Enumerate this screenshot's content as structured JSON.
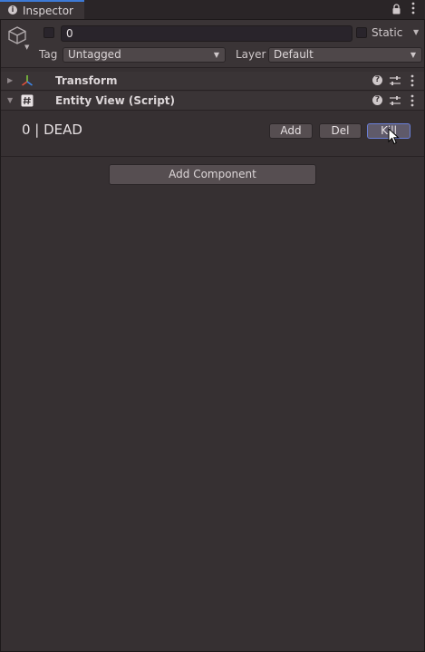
{
  "window": {
    "tab_label": "Inspector",
    "info_icon": "info-icon",
    "lock_icon": "lock-icon"
  },
  "header": {
    "object_name": "0",
    "active": false,
    "static_label": "Static",
    "static": false,
    "tag_label": "Tag",
    "tag_value": "Untagged",
    "layer_label": "Layer",
    "layer_value": "Default"
  },
  "components": [
    {
      "title": "Transform",
      "expanded": false,
      "icon": "transform-axes-icon"
    },
    {
      "title": "Entity View (Script)",
      "expanded": true,
      "icon": "script-hash-icon"
    }
  ],
  "entity_view": {
    "status_text": "0 | DEAD",
    "buttons": {
      "add": "Add",
      "del": "Del",
      "kill": "Kill"
    },
    "hovered_button": "kill"
  },
  "add_component_label": "Add Component",
  "colors": {
    "background": "#363032",
    "highlight": "#6a7fd8",
    "tab_accent": "#3d7ad6"
  }
}
